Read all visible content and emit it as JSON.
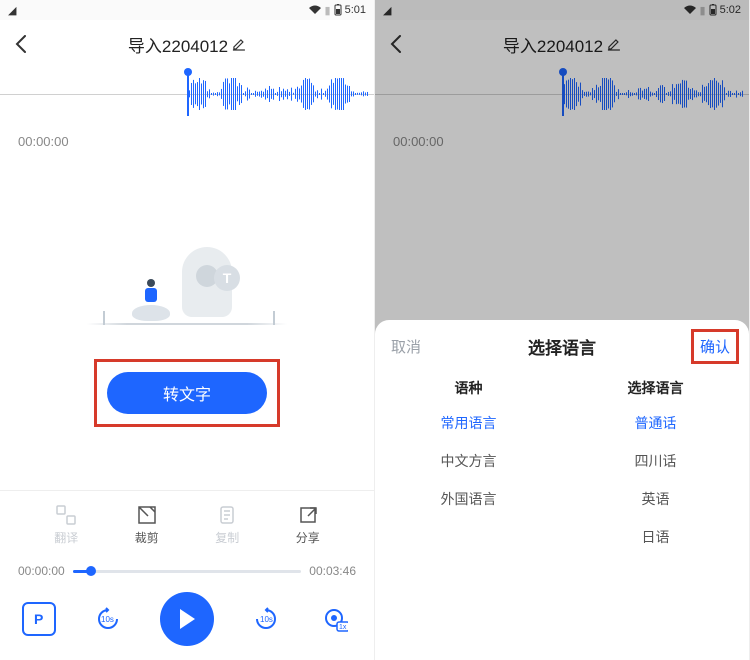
{
  "screen1": {
    "status_time": "5:01",
    "header_title": "导入2204012",
    "time_top": "00:00:00",
    "illus_badge": "T",
    "primary_button": "转文字",
    "toolbar": [
      {
        "label": "翻译",
        "enabled": false
      },
      {
        "label": "裁剪",
        "enabled": true
      },
      {
        "label": "复制",
        "enabled": false
      },
      {
        "label": "分享",
        "enabled": true
      }
    ],
    "progress_current": "00:00:00",
    "progress_total": "00:03:46",
    "rewind_label": "10s",
    "forward_label": "10s",
    "speed_label": "1x"
  },
  "screen2": {
    "status_time": "5:02",
    "header_title": "导入2204012",
    "time_top": "00:00:00",
    "sheet": {
      "cancel": "取消",
      "title": "选择语言",
      "confirm": "确认",
      "col1_header": "语种",
      "col2_header": "选择语言",
      "col1_items": [
        "常用语言",
        "中文方言",
        "外国语言"
      ],
      "col1_selected_index": 0,
      "col2_items": [
        "普通话",
        "四川话",
        "英语",
        "日语"
      ],
      "col2_selected_index": 0
    }
  }
}
